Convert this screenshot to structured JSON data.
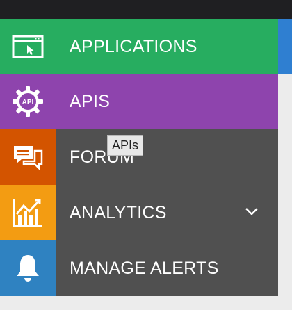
{
  "menu": {
    "items": [
      {
        "label": "APPLICATIONS",
        "icon": "application-window-icon",
        "color": "#27ad60"
      },
      {
        "label": "APIS",
        "icon": "api-gear-icon",
        "color": "#8e44ad"
      },
      {
        "label": "FORUM",
        "icon": "chat-bubbles-icon",
        "color": "#d35400"
      },
      {
        "label": "ANALYTICS",
        "icon": "bar-chart-icon",
        "color": "#f39c12"
      },
      {
        "label": "MANAGE ALERTS",
        "icon": "bell-icon",
        "color": "#2f82c1"
      }
    ]
  },
  "tooltip": {
    "text": "APIs"
  },
  "icons": {
    "api_badge": "API"
  },
  "colors": {
    "topbar": "#1f1f22",
    "menu_gray": "#505050",
    "accent_blue": "#2f7fd1"
  }
}
